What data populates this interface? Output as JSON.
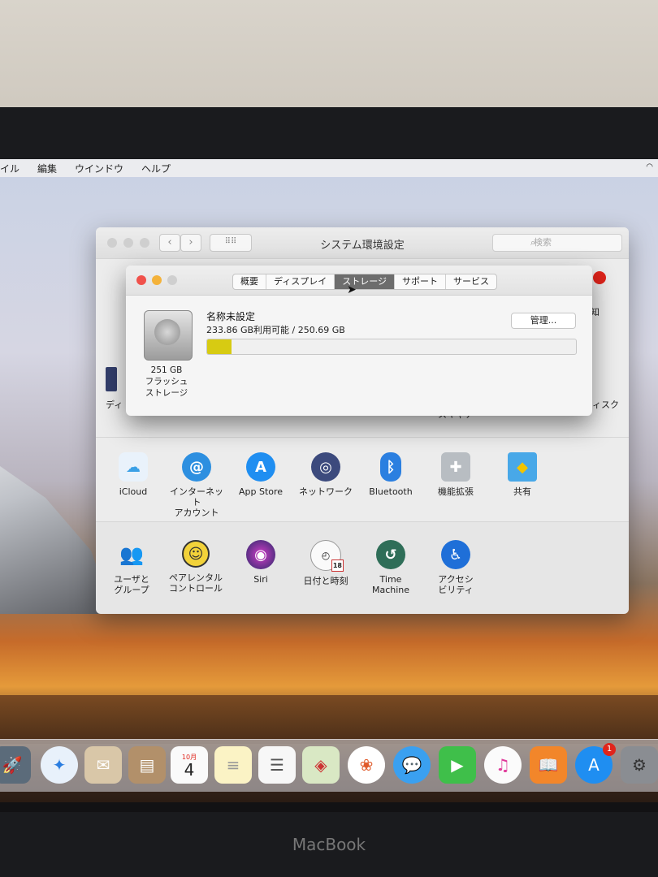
{
  "menubar": {
    "items": [
      "イル",
      "編集",
      "ウインドウ",
      "ヘルプ"
    ]
  },
  "prefs": {
    "title": "システム環境設定",
    "search_placeholder": "検索",
    "grid_icon": "grid-icon",
    "partial_left_label": "ディ",
    "partial_right_top": "知",
    "partial_right_label": "ィスク",
    "partial_right_label2": "スキャナ",
    "row2": [
      {
        "label": "iCloud",
        "icon": "cloud-icon"
      },
      {
        "label": "インターネット\nアカウント",
        "icon": "at-icon"
      },
      {
        "label": "App Store",
        "icon": "appstore-icon"
      },
      {
        "label": "ネットワーク",
        "icon": "globe-icon"
      },
      {
        "label": "Bluetooth",
        "icon": "bluetooth-icon"
      },
      {
        "label": "機能拡張",
        "icon": "puzzle-icon"
      },
      {
        "label": "共有",
        "icon": "folder-icon"
      }
    ],
    "row3": [
      {
        "label": "ユーザと\nグループ",
        "icon": "users-icon"
      },
      {
        "label": "ペアレンタル\nコントロール",
        "icon": "parental-icon"
      },
      {
        "label": "Siri",
        "icon": "siri-icon"
      },
      {
        "label": "日付と時刻",
        "icon": "clock-icon"
      },
      {
        "label": "Time\nMachine",
        "icon": "timemachine-icon"
      },
      {
        "label": "アクセシ\nビリティ",
        "icon": "accessibility-icon"
      }
    ]
  },
  "about": {
    "tabs": [
      "概要",
      "ディスプレイ",
      "ストレージ",
      "サポート",
      "サービス"
    ],
    "selected_tab": "ストレージ",
    "disk_size": "251 GB",
    "disk_type_1": "フラッシュ",
    "disk_type_2": "ストレージ",
    "volume_name": "名称未設定",
    "availability": "233.86 GB利用可能 / 250.69 GB",
    "manage_label": "管理...",
    "used_fraction": 0.067
  },
  "dock": {
    "calendar_month": "10月",
    "calendar_day": "4",
    "appstore_badge": "1",
    "clock_date": "18"
  },
  "device_brand": "MacBook"
}
